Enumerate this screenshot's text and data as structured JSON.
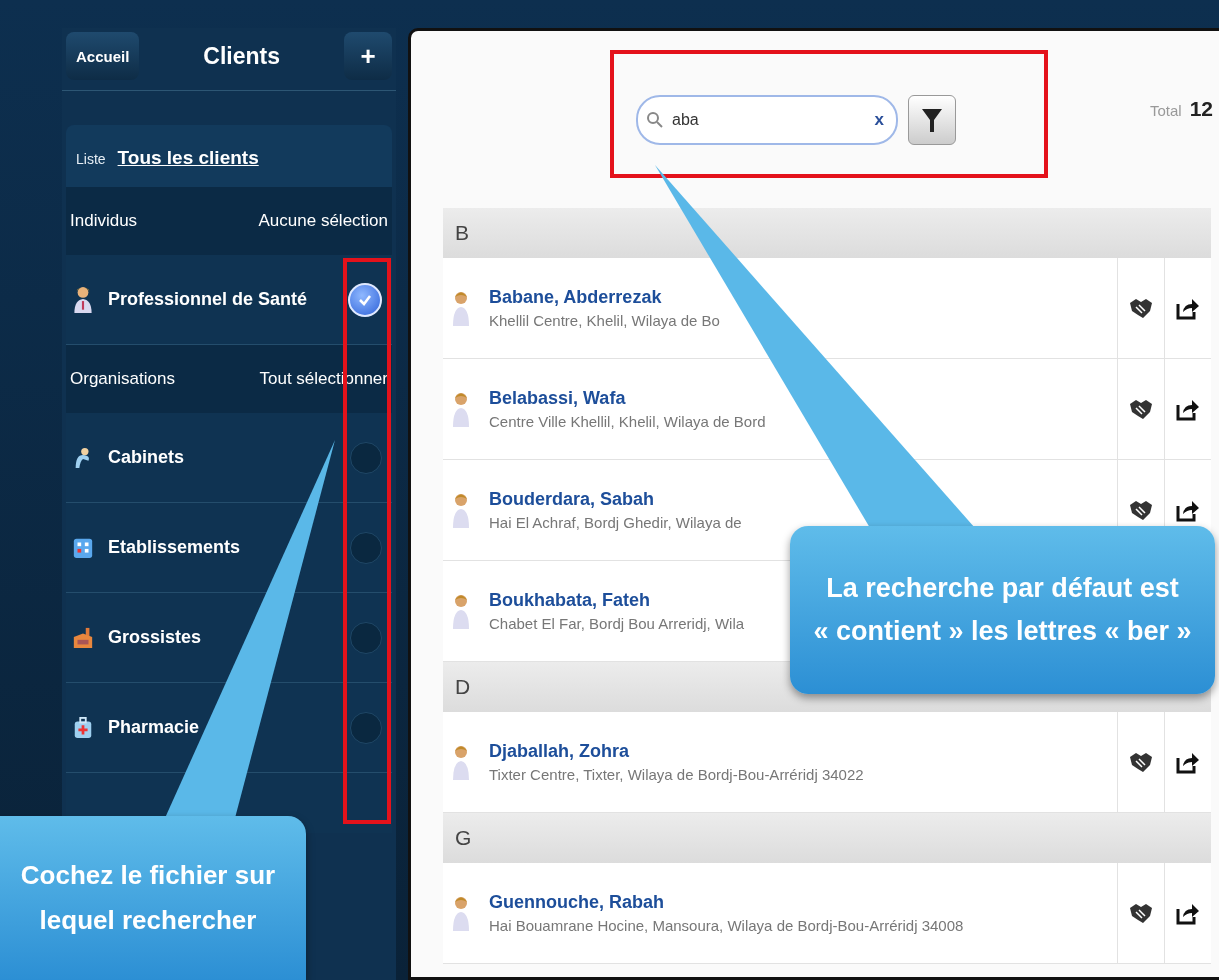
{
  "sidebar": {
    "home_button": "Accueil",
    "title": "Clients",
    "add_button": "+",
    "list_label": "Liste",
    "list_value": "Tous les clients",
    "sections": [
      {
        "title": "Individus",
        "action": "Aucune sélection",
        "items": [
          {
            "label": "Professionnel de Santé",
            "kind": "individual",
            "checked": true
          }
        ]
      },
      {
        "title": "Organisations",
        "action": "Tout sélectionner",
        "items": [
          {
            "label": "Cabinets",
            "kind": "cabinet",
            "checked": false
          },
          {
            "label": "Etablissements",
            "kind": "establishment",
            "checked": false
          },
          {
            "label": "Grossistes",
            "kind": "wholesaler",
            "checked": false
          },
          {
            "label": "Pharmacie",
            "kind": "pharmacy",
            "checked": false
          }
        ]
      }
    ]
  },
  "search": {
    "value": "aba",
    "clear": "x"
  },
  "total": {
    "label": "Total",
    "value": "12"
  },
  "groups": [
    {
      "letter": "B",
      "clients": [
        {
          "name": "Babane, Abderrezak",
          "address": "Khellil Centre, Khelil, Wilaya de Bo",
          "actions_covered": false
        },
        {
          "name": "Belabassi, Wafa",
          "address": "Centre Ville Khellil, Khelil, Wilaya de Bord",
          "actions_covered": false
        },
        {
          "name": "Bouderdara, Sabah",
          "address": "Hai El Achraf, Bordj Ghedir, Wilaya de",
          "actions_covered": false
        },
        {
          "name": "Boukhabata, Fateh",
          "address": "Chabet El Far, Bordj Bou Arreridj, Wila"
        }
      ]
    },
    {
      "letter": "D",
      "clients": [
        {
          "name": "Djaballah, Zohra",
          "address": "Tixter Centre, Tixter, Wilaya de Bordj-Bou-Arréridj 34022",
          "actions_covered": false
        }
      ]
    },
    {
      "letter": "G",
      "clients": [
        {
          "name": "Guennouche, Rabah",
          "address": "Hai Bouamrane Hocine, Mansoura, Wilaya de Bordj-Bou-Arréridj 34008",
          "actions_covered": false
        }
      ]
    }
  ],
  "callouts": [
    {
      "kind": "search",
      "lines": [
        "La recherche par défaut est",
        "« contient » les lettres « ber »"
      ]
    },
    {
      "kind": "filter",
      "lines": [
        "Cochez le fichier sur",
        "lequel rechercher"
      ]
    }
  ]
}
